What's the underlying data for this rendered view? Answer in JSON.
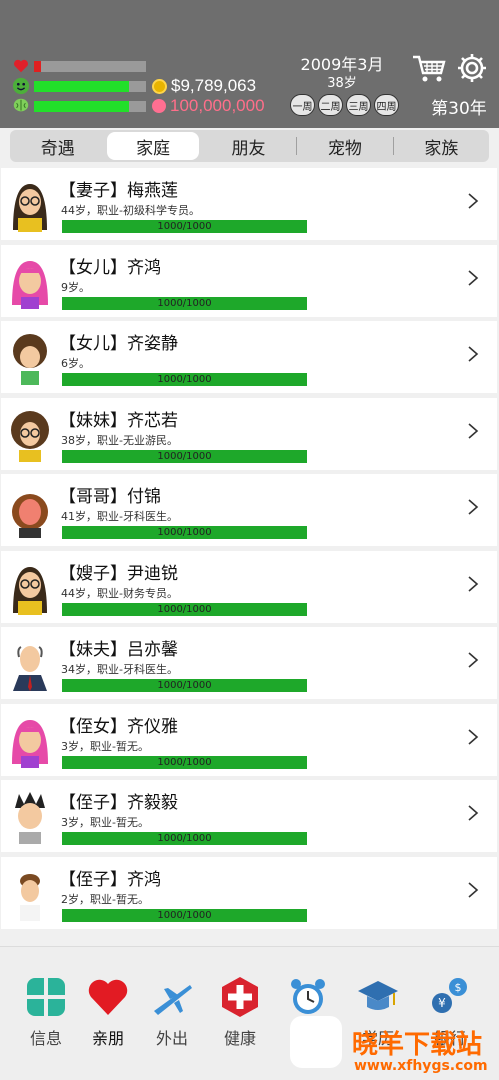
{
  "header": {
    "money": "$9,789,063",
    "diamonds": "100,000,000",
    "date": "2009年3月",
    "age": "38岁",
    "weeks": [
      "一周",
      "二周",
      "三周",
      "四周"
    ],
    "year": "第30年",
    "bars": {
      "health": 0.06,
      "happiness": 0.85,
      "smarts": 0.85
    },
    "icons": {
      "health": "heart-icon",
      "happiness": "smiley-icon",
      "smarts": "brain-icon",
      "money": "coin-icon",
      "diamonds": "gem-icon",
      "shop": "cart-icon",
      "settings": "gear-icon"
    }
  },
  "tabs": [
    "奇遇",
    "家庭",
    "朋友",
    "宠物",
    "家族"
  ],
  "active_tab": "家庭",
  "members": [
    {
      "name": "【妻子】梅燕莲",
      "desc": "44岁，职业-初级科学专员。",
      "hp": "1000/1000",
      "avatar": "woman-glasses"
    },
    {
      "name": "【女儿】齐鸿",
      "desc": "9岁。",
      "hp": "1000/1000",
      "avatar": "girl-pink-hair"
    },
    {
      "name": "【女儿】齐姿静",
      "desc": "6岁。",
      "hp": "1000/1000",
      "avatar": "girl-curly"
    },
    {
      "name": "【妹妹】齐芯若",
      "desc": "38岁，职业-无业游民。",
      "hp": "1000/1000",
      "avatar": "woman-glasses-curly"
    },
    {
      "name": "【哥哥】付锦",
      "desc": "41岁，职业-牙科医生。",
      "hp": "1000/1000",
      "avatar": "man-hat"
    },
    {
      "name": "【嫂子】尹迪锐",
      "desc": "44岁，职业-财务专员。",
      "hp": "1000/1000",
      "avatar": "woman-glasses"
    },
    {
      "name": "【妹夫】吕亦馨",
      "desc": "34岁，职业-牙科医生。",
      "hp": "1000/1000",
      "avatar": "bald-man-suit"
    },
    {
      "name": "【侄女】齐仪雅",
      "desc": "3岁，职业-暂无。",
      "hp": "1000/1000",
      "avatar": "girl-pink-hair"
    },
    {
      "name": "【侄子】齐毅毅",
      "desc": "3岁，职业-暂无。",
      "hp": "1000/1000",
      "avatar": "boy-spiky"
    },
    {
      "name": "【侄子】齐鸿",
      "desc": "2岁，职业-暂无。",
      "hp": "1000/1000",
      "avatar": "boy-plain"
    }
  ],
  "nav": [
    {
      "label": "信息",
      "icon": "info-grid-icon"
    },
    {
      "label": "亲朋",
      "icon": "heart-icon"
    },
    {
      "label": "外出",
      "icon": "airplane-icon"
    },
    {
      "label": "健康",
      "icon": "medical-cross-icon"
    },
    {
      "label": "",
      "icon": "alarm-clock-icon"
    },
    {
      "label": "学历",
      "icon": "graduation-cap-icon"
    },
    {
      "label": "银行",
      "icon": "bank-coin-icon"
    }
  ],
  "watermark": {
    "title": "晓羊下载站",
    "url": "www.xfhygs.com"
  },
  "colors": {
    "header_bg": "#6e6e6e",
    "bar_green": "#22e02a",
    "hp_green": "#1ea82a",
    "bar_red": "#e02020"
  }
}
